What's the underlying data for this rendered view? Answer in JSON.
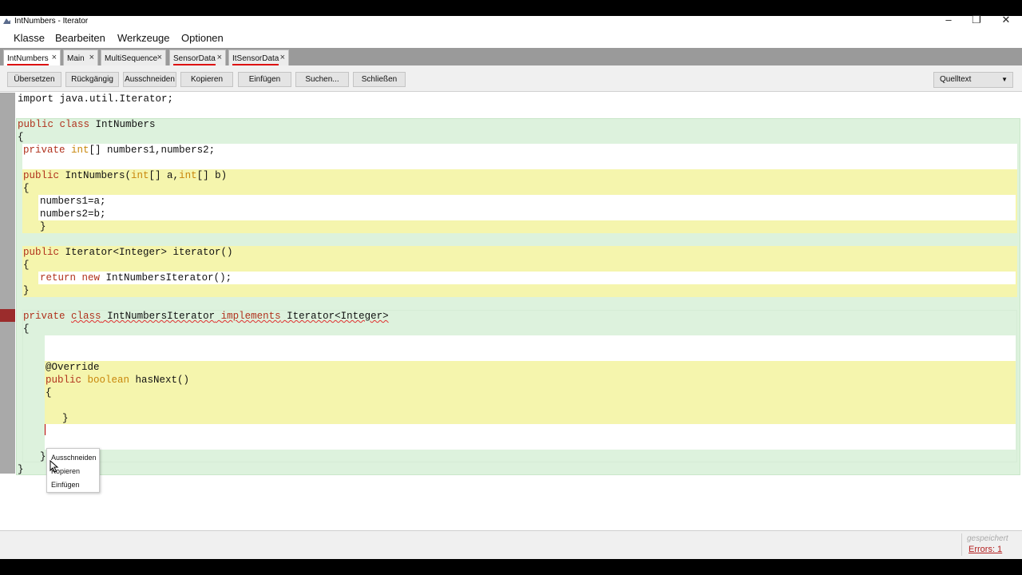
{
  "window": {
    "title": "IntNumbers - Iterator",
    "minimize": "–",
    "maximize": "❐",
    "close": "✕"
  },
  "menu": [
    "Klasse",
    "Bearbeiten",
    "Werkzeuge",
    "Optionen"
  ],
  "tabs": [
    {
      "label": "IntNumbers",
      "close": "×"
    },
    {
      "label": "Main",
      "close": "×"
    },
    {
      "label": "MultiSequence",
      "close": "×"
    },
    {
      "label": "SensorData",
      "close": "×"
    },
    {
      "label": "ItSensorData",
      "close": "×"
    }
  ],
  "toolbar": {
    "buttons": [
      "Übersetzen",
      "Rückgängig",
      "Ausschneiden",
      "Kopieren",
      "Einfügen",
      "Suchen...",
      "Schließen"
    ],
    "mode": "Quelltext",
    "mode_chevron": "▼"
  },
  "code": {
    "l1": "import java.util.Iterator;",
    "l2_kw": "public class",
    "l2_name": " IntNumbers",
    "brace_open": "{",
    "brace_close": "}",
    "l4_kw": "private",
    "l4_type": "int",
    "l4_rest": "[] numbers1,numbers2;",
    "l5_kw": "public",
    "l5_a": " IntNumbers(",
    "l5_t1": "int",
    "l5_b": "[] a,",
    "l5_t2": "int",
    "l5_c": "[] b)",
    "l6": "numbers1=a;",
    "l7": "numbers2=b;",
    "l8_kw": "public",
    "l8_rest": " Iterator<Integer> iterator()",
    "l9_kw1": "return",
    "l9_kw2": "new",
    "l9_rest": " IntNumbersIterator();",
    "l10_kw": "private",
    "l10_class": "class",
    "l10_name": "IntNumbersIterator",
    "l10_impl": "implements",
    "l10_iface": "Iterator<Integer>",
    "l11": "@Override",
    "l12_kw": "public",
    "l12_type": "boolean",
    "l12_rest": " hasNext()"
  },
  "context_menu": [
    "Ausschneiden",
    "Kopieren",
    "Einfügen"
  ],
  "status": {
    "saved": "gespeichert",
    "errors": "Errors: 1"
  }
}
